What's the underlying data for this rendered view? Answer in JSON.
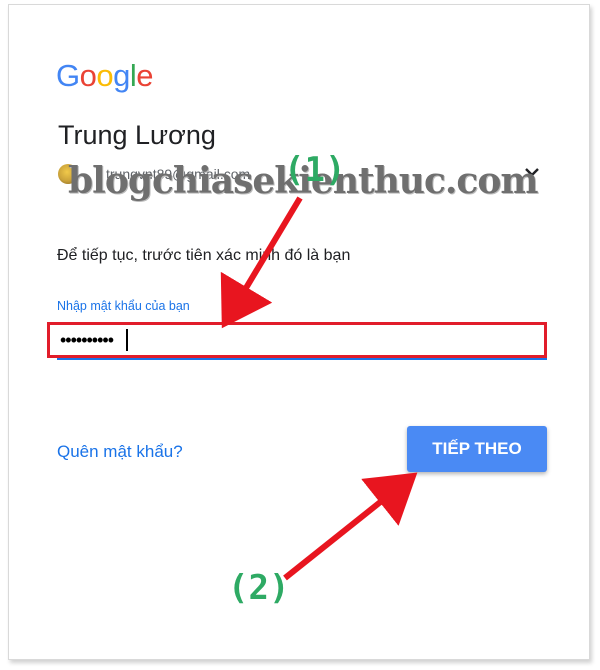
{
  "brand": {
    "letters": [
      "G",
      "o",
      "o",
      "g",
      "l",
      "e"
    ],
    "colors": [
      "#4285F4",
      "#EA4335",
      "#FBBC05",
      "#4285F4",
      "#34A853",
      "#EA4335"
    ]
  },
  "account": {
    "name": "Trung Lương",
    "email": "trungvnt89@gmail.com",
    "avatar_icon": "avatar-icon",
    "chevron_icon": "chevron-down-icon"
  },
  "watermark": "blogchiasekienthuc.com",
  "form": {
    "subtitle": "Để tiếp tục, trước tiên xác minh đó là bạn",
    "password_label": "Nhập mật khẩu của bạn",
    "password_value": "••••••••••",
    "forgot_link": "Quên mật khẩu?",
    "next_button": "TIẾP THEO"
  },
  "annotations": {
    "step1": "(1)",
    "step2": "(2)",
    "arrow_color": "#e8151f",
    "label_color": "#2eaa64"
  },
  "colors": {
    "accent": "#1a73e8",
    "button": "#4a8af4",
    "highlight_border": "#e11d2a"
  }
}
